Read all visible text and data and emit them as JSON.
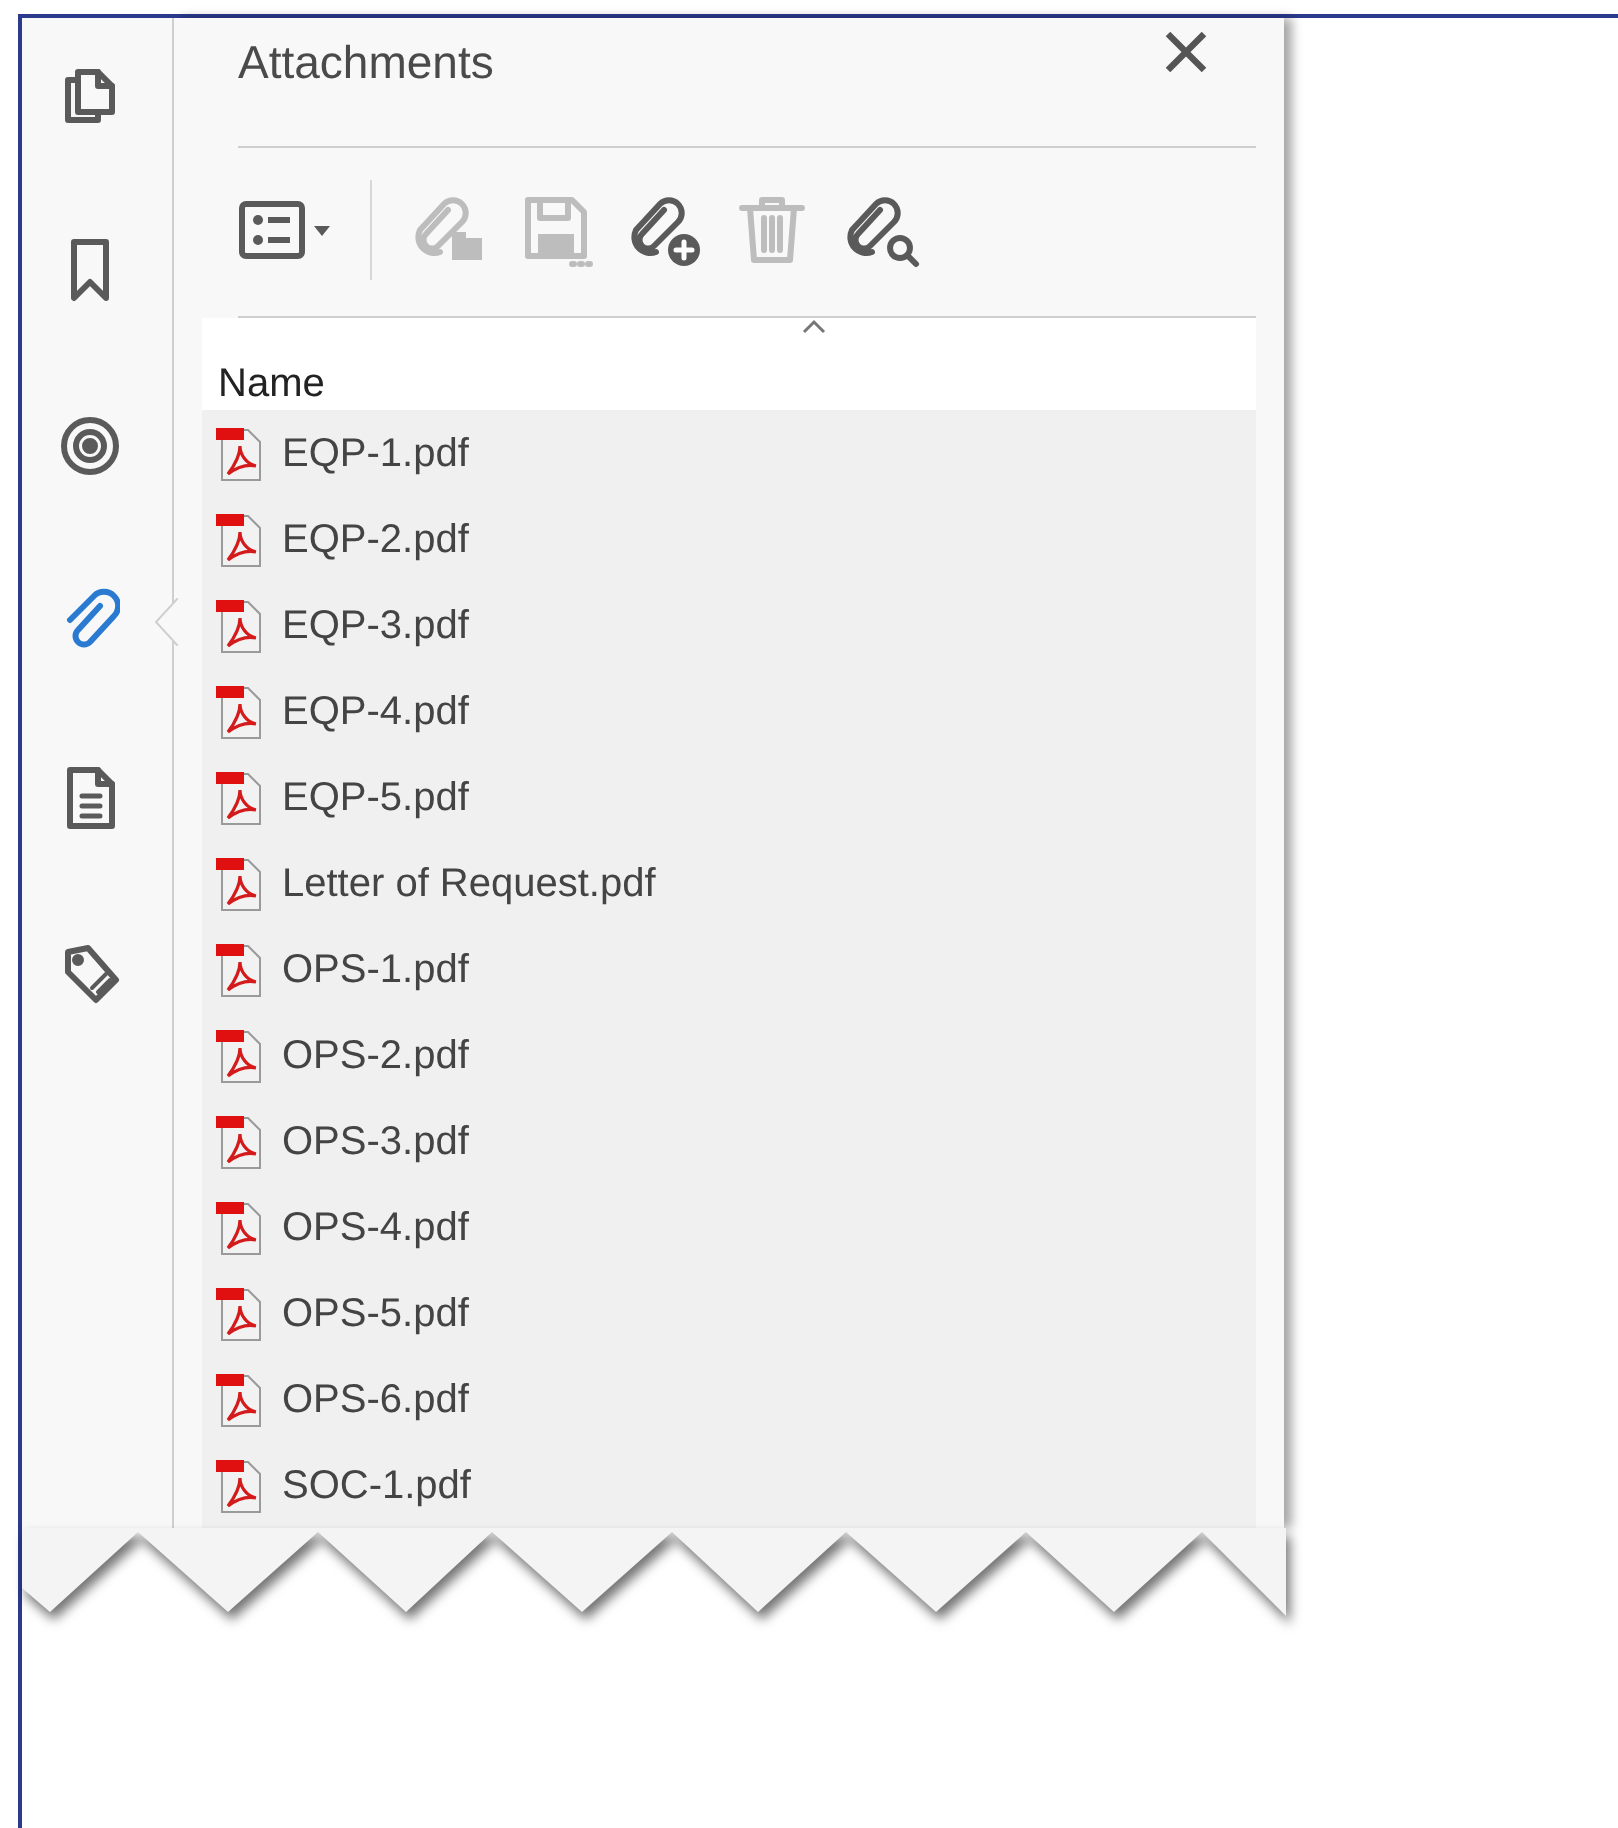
{
  "sidebar": {
    "items": [
      {
        "kind": "pages",
        "selected": false
      },
      {
        "kind": "bookmark",
        "selected": false
      },
      {
        "kind": "layers",
        "selected": false
      },
      {
        "kind": "attachment",
        "selected": true
      },
      {
        "kind": "document",
        "selected": false
      },
      {
        "kind": "tag",
        "selected": false
      }
    ]
  },
  "panel": {
    "title": "Attachments",
    "toolbar": [
      {
        "kind": "options",
        "disabled": false
      },
      {
        "kind": "open",
        "disabled": true
      },
      {
        "kind": "save",
        "disabled": true
      },
      {
        "kind": "add",
        "disabled": false
      },
      {
        "kind": "delete",
        "disabled": true
      },
      {
        "kind": "search",
        "disabled": false
      }
    ],
    "column_header": "Name",
    "files": [
      {
        "name": "EQP-1.pdf"
      },
      {
        "name": "EQP-2.pdf"
      },
      {
        "name": "EQP-3.pdf"
      },
      {
        "name": "EQP-4.pdf"
      },
      {
        "name": "EQP-5.pdf"
      },
      {
        "name": "Letter of Request.pdf"
      },
      {
        "name": "OPS-1.pdf"
      },
      {
        "name": "OPS-2.pdf"
      },
      {
        "name": "OPS-3.pdf"
      },
      {
        "name": "OPS-4.pdf"
      },
      {
        "name": "OPS-5.pdf"
      },
      {
        "name": "OPS-6.pdf"
      },
      {
        "name": "SOC-1.pdf"
      }
    ]
  }
}
